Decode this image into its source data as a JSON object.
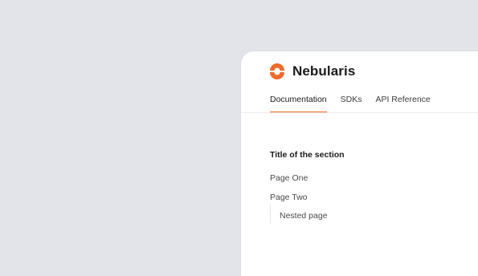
{
  "brand": {
    "name": "Nebularis",
    "logo_icon": "nebularis-logo-icon",
    "accent_color": "#ee6a2b"
  },
  "tabs": [
    {
      "label": "Documentation",
      "active": true
    },
    {
      "label": "SDKs",
      "active": false
    },
    {
      "label": "API Reference",
      "active": false
    }
  ],
  "sidebar": {
    "section_title": "Title of the section",
    "items": [
      {
        "label": "Page One"
      },
      {
        "label": "Page Two"
      }
    ],
    "nested_items": [
      {
        "label": "Nested page"
      }
    ]
  }
}
